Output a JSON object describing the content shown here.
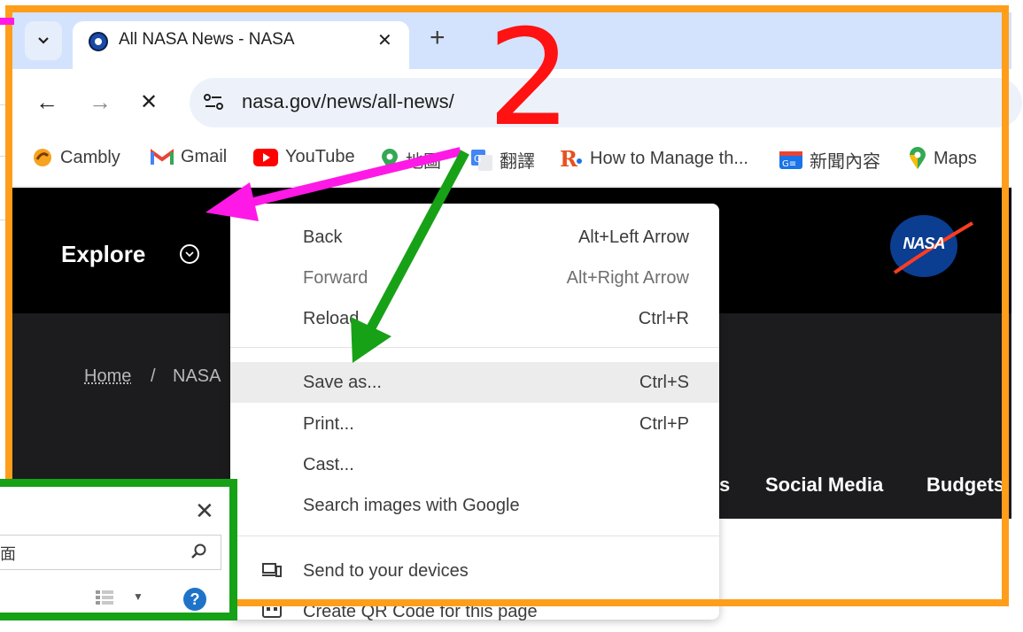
{
  "browser": {
    "tab_list_icon": "chevron-down-icon",
    "tab": {
      "title": "All NASA News - NASA",
      "favicon": "nasa-favicon-icon",
      "close": "✕"
    },
    "new_tab": "+",
    "nav": {
      "back": "←",
      "forward": "→",
      "stop": "✕"
    },
    "url": "nasa.gov/news/all-news/",
    "bookmarks": [
      {
        "label": "Cambly",
        "icon": "cambly-icon",
        "color": "#f6a321"
      },
      {
        "label": "Gmail",
        "icon": "gmail-icon",
        "color": "#ea4335"
      },
      {
        "label": "YouTube",
        "icon": "youtube-icon",
        "color": "#ff0000"
      },
      {
        "label": "地圖",
        "icon": "maps-pin-icon",
        "color": "#fbbc04"
      },
      {
        "label": "翻譯",
        "icon": "translate-icon",
        "color": "#4285f4"
      },
      {
        "label": "How to Manage th...",
        "icon": "r-logo-icon",
        "color": "#e8501f"
      },
      {
        "label": "新聞內容",
        "icon": "news-icon",
        "color": "#1a73e8"
      },
      {
        "label": "Maps",
        "icon": "maps-pin-icon",
        "color": "#fbbc04"
      }
    ]
  },
  "page": {
    "explore": "Explore",
    "logo_text": "NASA",
    "breadcrumb": {
      "home": "Home",
      "sep": "/",
      "current": "NASA"
    },
    "nav_tail": "s",
    "nav_social": "Social Media",
    "nav_budgets": "Budgets"
  },
  "context_menu": {
    "items": [
      {
        "label": "Back",
        "shortcut": "Alt+Left Arrow"
      },
      {
        "label": "Forward",
        "shortcut": "Alt+Right Arrow"
      },
      {
        "label": "Reload",
        "shortcut": "Ctrl+R"
      },
      {
        "label": "Save as...",
        "shortcut": "Ctrl+S"
      },
      {
        "label": "Print...",
        "shortcut": "Ctrl+P"
      },
      {
        "label": "Cast...",
        "shortcut": ""
      },
      {
        "label": "Search images with Google",
        "shortcut": ""
      },
      {
        "label": "Send to your devices",
        "shortcut": ""
      },
      {
        "label": "Create QR Code for this page",
        "shortcut": ""
      }
    ],
    "highlighted": "Save as..."
  },
  "dialog": {
    "close": "✕",
    "search_text": "面",
    "help": "?"
  },
  "annotation": {
    "step_number": "2",
    "colors": {
      "frame": "#ff9e1b",
      "magenta_arrow": "#ff19e6",
      "green_arrow": "#17a117",
      "number": "#ff1212"
    }
  }
}
